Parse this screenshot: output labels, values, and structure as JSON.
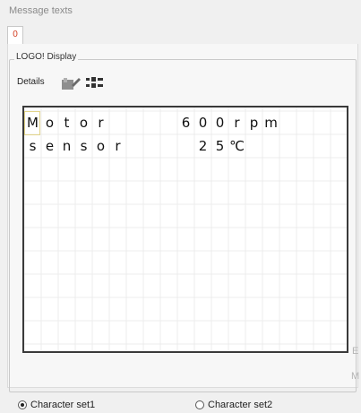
{
  "window": {
    "title": "Message texts"
  },
  "tabs": [
    {
      "label": "0",
      "color": "#d23a1e"
    }
  ],
  "group": {
    "label": "LOGO! Display"
  },
  "toolbar": {
    "details_label": "Details",
    "icons": [
      "edit-pencil-icon",
      "settings-icon"
    ]
  },
  "display": {
    "line1": [
      "M",
      "o",
      "t",
      "o",
      "r",
      " ",
      " ",
      " ",
      " ",
      "6",
      "0",
      "0",
      "r",
      "p",
      "m",
      ""
    ],
    "line2": [
      "s",
      "e",
      "n",
      "s",
      "o",
      "r",
      " ",
      " ",
      " ",
      " ",
      "2",
      "5",
      "℃",
      "",
      "",
      ""
    ],
    "cursor": {
      "row": 1,
      "col": 1
    }
  },
  "clipped_right": {
    "a": "E",
    "b": "M"
  },
  "character_sets": [
    {
      "label": "Character set1",
      "selected": true
    },
    {
      "label": "Character set2",
      "selected": false
    }
  ]
}
